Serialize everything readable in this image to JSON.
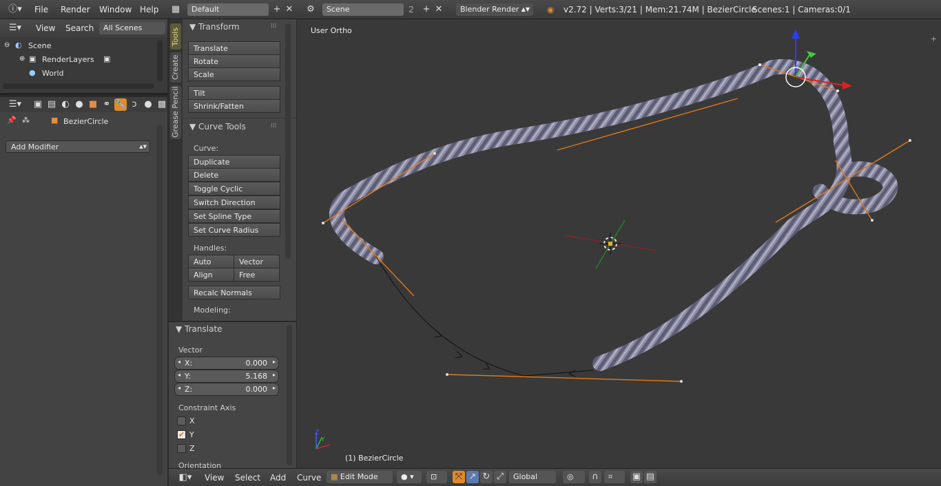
{
  "topbar": {
    "menus": [
      "File",
      "Render",
      "Window",
      "Help"
    ],
    "layout_name": "Default",
    "scene_name": "Scene",
    "scene_count": "2",
    "engine": "Blender Render",
    "stats": "v2.72 | Verts:3/21 | Mem:21.74M | BezierCircle",
    "scenes_info": "Scenes:1 | Cameras:0/1"
  },
  "outliner": {
    "view": "View",
    "search": "Search",
    "filter": "All Scenes",
    "items": [
      "Scene",
      "RenderLayers",
      "World"
    ]
  },
  "properties": {
    "object_name": "BezierCircle",
    "add_modifier": "Add Modifier"
  },
  "tabs": [
    "Tools",
    "Create",
    "Grease Pencil"
  ],
  "toolshelf": {
    "transform_title": "Transform",
    "transform_buttons": [
      "Translate",
      "Rotate",
      "Scale"
    ],
    "tilt_buttons": [
      "Tilt",
      "Shrink/Fatten"
    ],
    "curve_tools_title": "Curve Tools",
    "curve_label": "Curve:",
    "curve_buttons": [
      "Duplicate",
      "Delete",
      "Toggle Cyclic",
      "Switch Direction",
      "Set Spline Type",
      "Set Curve Radius"
    ],
    "handles_label": "Handles:",
    "handles": [
      "Auto",
      "Vector",
      "Align",
      "Free"
    ],
    "recalc": "Recalc Normals",
    "modeling_label": "Modeling:"
  },
  "redo": {
    "title": "Translate",
    "vector_label": "Vector",
    "x_label": "X:",
    "x_value": "0.000",
    "y_label": "Y:",
    "y_value": "5.168",
    "z_label": "Z:",
    "z_value": "0.000",
    "constraint_label": "Constraint Axis",
    "axes": [
      "X",
      "Y",
      "Z"
    ],
    "axes_checked": [
      false,
      true,
      false
    ],
    "orientation_label": "Orientation"
  },
  "viewport": {
    "view_label": "User Ortho",
    "object_label": "(1) BezierCircle"
  },
  "bottombar": {
    "menus": [
      "View",
      "Select",
      "Add",
      "Curve"
    ],
    "mode": "Edit Mode",
    "orientation": "Global"
  },
  "colors": {
    "accent": "#e08a2a",
    "handle": "#e07a1a",
    "rope": "#8a8aa0"
  }
}
